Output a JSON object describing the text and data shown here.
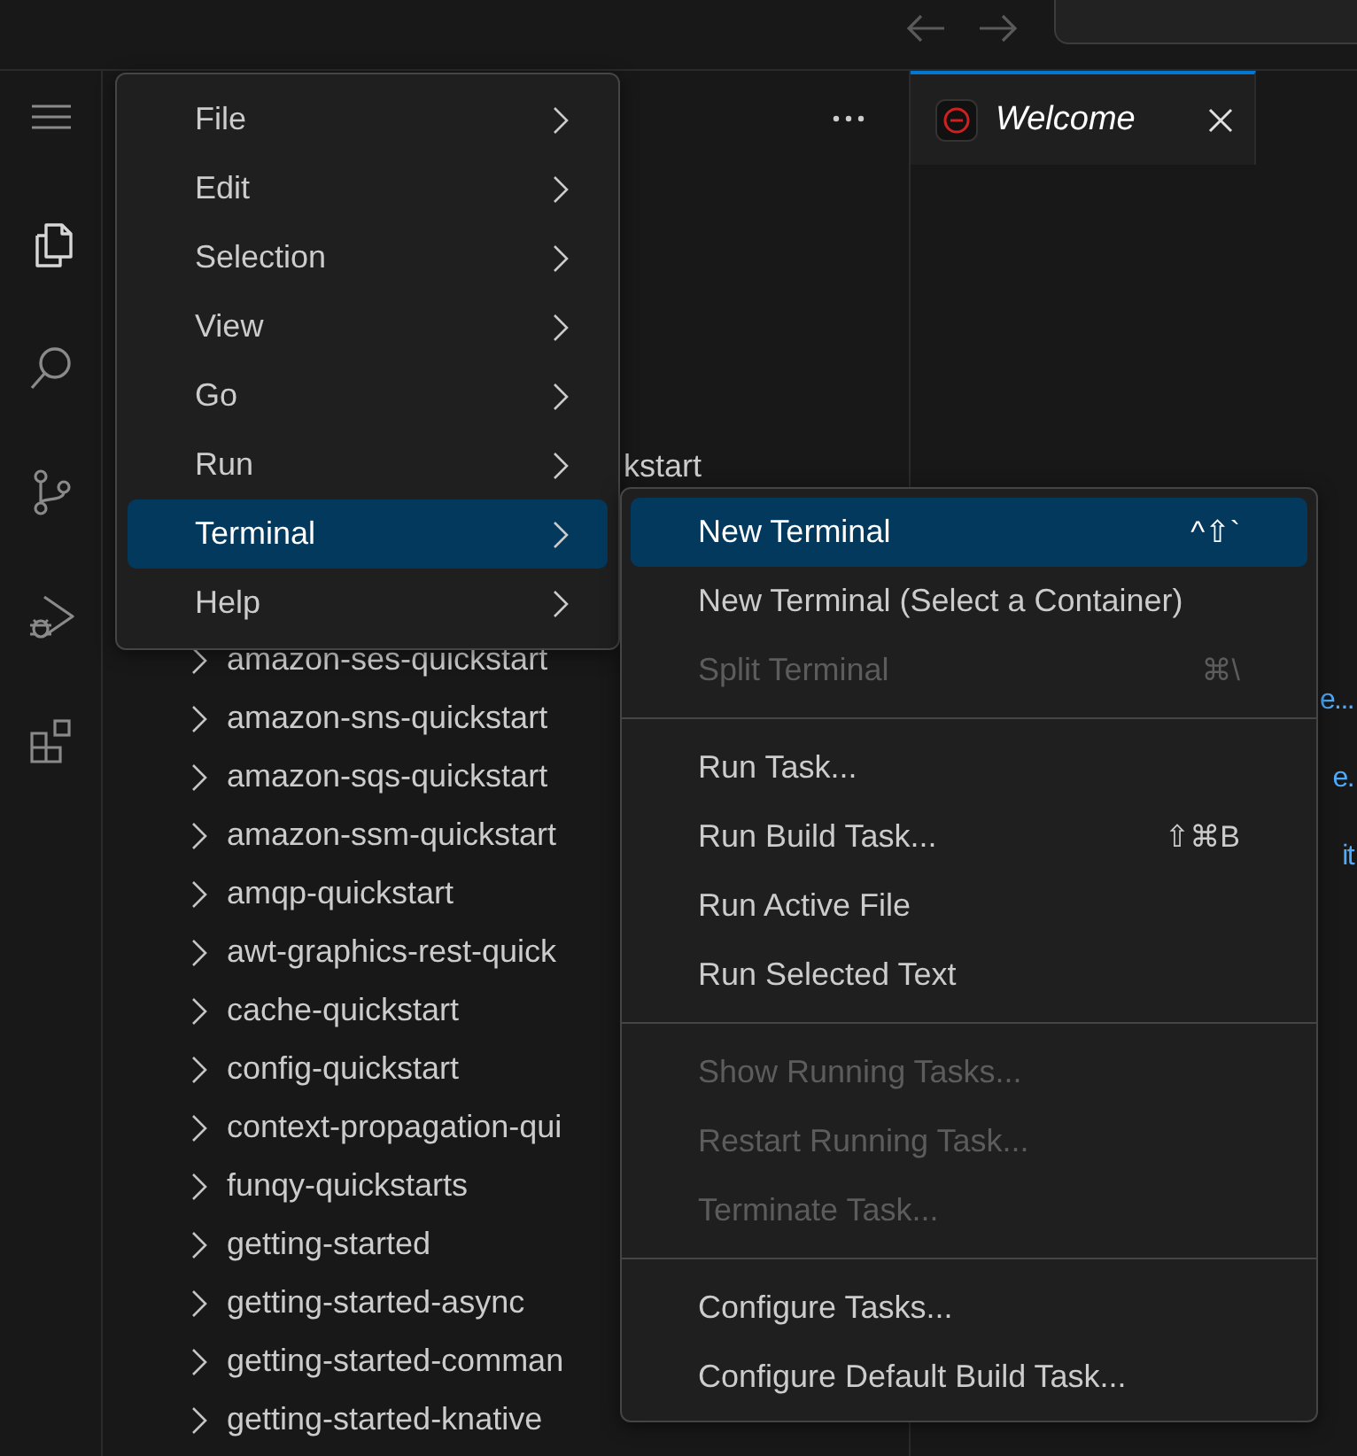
{
  "activity_bar": {
    "items": [
      {
        "kind": "menu",
        "selected": false
      },
      {
        "kind": "files",
        "selected": true
      },
      {
        "kind": "search",
        "selected": false
      },
      {
        "kind": "source-control",
        "selected": false
      },
      {
        "kind": "run-debug",
        "selected": false
      },
      {
        "kind": "extensions",
        "selected": false
      }
    ]
  },
  "explorer": {
    "tree": [
      {
        "kind": "fragment",
        "label": "kstart"
      },
      {
        "kind": "folder",
        "label": "amazon-ses-quickstart"
      },
      {
        "kind": "folder",
        "label": "amazon-sns-quickstart"
      },
      {
        "kind": "folder",
        "label": "amazon-sqs-quickstart"
      },
      {
        "kind": "folder",
        "label": "amazon-ssm-quickstart"
      },
      {
        "kind": "folder",
        "label": "amqp-quickstart"
      },
      {
        "kind": "folder",
        "label": "awt-graphics-rest-quick"
      },
      {
        "kind": "folder",
        "label": "cache-quickstart"
      },
      {
        "kind": "folder",
        "label": "config-quickstart"
      },
      {
        "kind": "folder",
        "label": "context-propagation-qui"
      },
      {
        "kind": "folder",
        "label": "funqy-quickstarts"
      },
      {
        "kind": "folder",
        "label": "getting-started"
      },
      {
        "kind": "folder",
        "label": "getting-started-async"
      },
      {
        "kind": "folder",
        "label": "getting-started-comman"
      },
      {
        "kind": "folder",
        "label": "getting-started-knative"
      }
    ]
  },
  "editor": {
    "tab": {
      "title": "Welcome",
      "active": true
    },
    "link_fragments": [
      "e...",
      "e.",
      "it"
    ]
  },
  "menu": {
    "items": [
      {
        "label": "File",
        "selected": false
      },
      {
        "label": "Edit",
        "selected": false
      },
      {
        "label": "Selection",
        "selected": false
      },
      {
        "label": "View",
        "selected": false
      },
      {
        "label": "Go",
        "selected": false
      },
      {
        "label": "Run",
        "selected": false
      },
      {
        "label": "Terminal",
        "selected": true
      },
      {
        "label": "Help",
        "selected": false
      }
    ]
  },
  "submenu": {
    "items": [
      {
        "kind": "item",
        "label": "New Terminal",
        "shortcut": "^⇧`",
        "disabled": false,
        "selected": true
      },
      {
        "kind": "item",
        "label": "New Terminal (Select a Container)",
        "disabled": false,
        "selected": false
      },
      {
        "kind": "item",
        "label": "Split Terminal",
        "shortcut": "⌘\\",
        "disabled": true,
        "selected": false
      },
      {
        "kind": "separator"
      },
      {
        "kind": "item",
        "label": "Run Task...",
        "disabled": false,
        "selected": false
      },
      {
        "kind": "item",
        "label": "Run Build Task...",
        "shortcut": "⇧⌘B",
        "disabled": false,
        "selected": false
      },
      {
        "kind": "item",
        "label": "Run Active File",
        "disabled": false,
        "selected": false
      },
      {
        "kind": "item",
        "label": "Run Selected Text",
        "disabled": false,
        "selected": false
      },
      {
        "kind": "separator"
      },
      {
        "kind": "item",
        "label": "Show Running Tasks...",
        "disabled": true,
        "selected": false
      },
      {
        "kind": "item",
        "label": "Restart Running Task...",
        "disabled": true,
        "selected": false
      },
      {
        "kind": "item",
        "label": "Terminate Task...",
        "disabled": true,
        "selected": false
      },
      {
        "kind": "separator"
      },
      {
        "kind": "item",
        "label": "Configure Tasks...",
        "disabled": false,
        "selected": false
      },
      {
        "kind": "item",
        "label": "Configure Default Build Task...",
        "disabled": false,
        "selected": false
      }
    ]
  }
}
